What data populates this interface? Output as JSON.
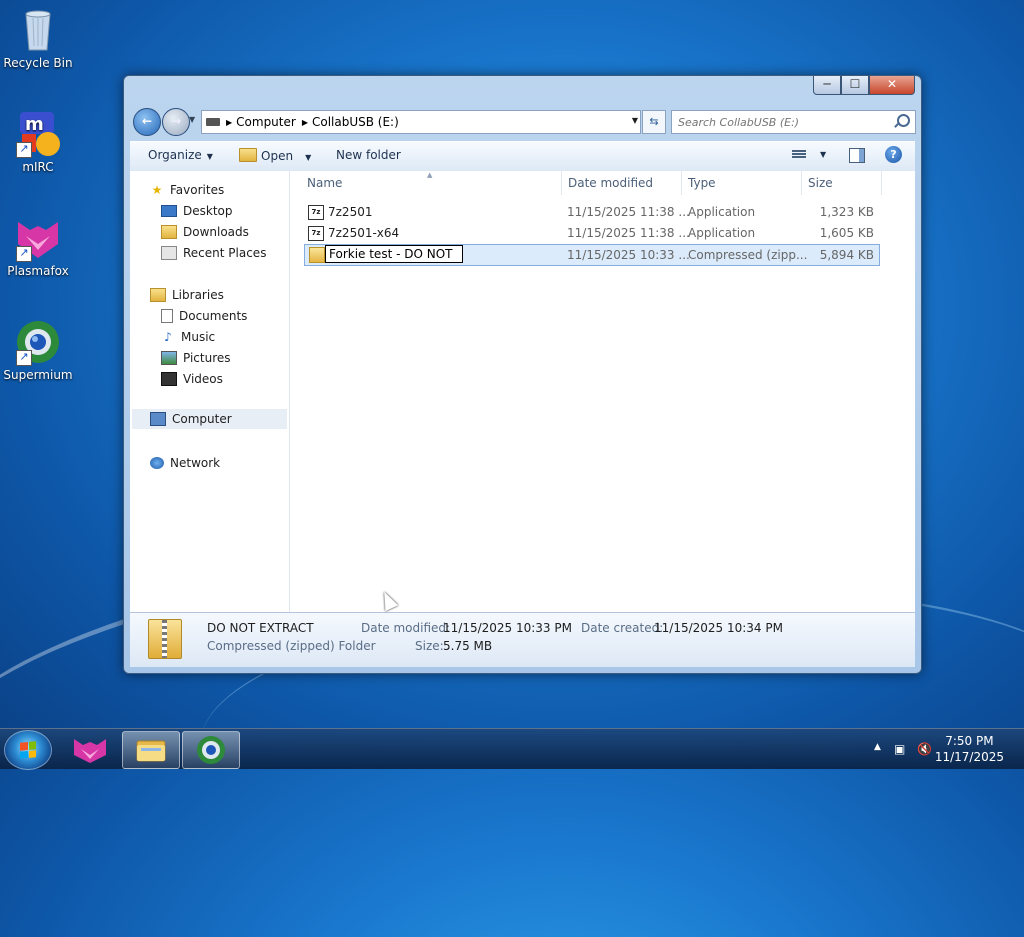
{
  "desktop": {
    "icons": [
      {
        "label": "Recycle Bin"
      },
      {
        "label": "mIRC"
      },
      {
        "label": "Plasmafox"
      },
      {
        "label": "Supermium"
      }
    ]
  },
  "window": {
    "caption": {
      "minimize": "─",
      "maximize": "☐",
      "close": "✕"
    },
    "address": {
      "root": "Computer",
      "drive": "CollabUSB (E:)"
    },
    "search": {
      "placeholder": "Search CollabUSB (E:)"
    },
    "toolbar": {
      "organize": "Organize",
      "open": "Open",
      "new_folder": "New folder"
    },
    "nav": {
      "favorites": "Favorites",
      "desktop": "Desktop",
      "downloads": "Downloads",
      "recent_places": "Recent Places",
      "libraries": "Libraries",
      "documents": "Documents",
      "music": "Music",
      "pictures": "Pictures",
      "videos": "Videos",
      "computer": "Computer",
      "network": "Network"
    },
    "columns": {
      "name": "Name",
      "date": "Date modified",
      "type": "Type",
      "size": "Size"
    },
    "files": [
      {
        "name": "7z2501",
        "date": "11/15/2025 11:38 ...",
        "type": "Application",
        "size": "1,323 KB"
      },
      {
        "name": "7z2501-x64",
        "date": "11/15/2025 11:38 ...",
        "type": "Application",
        "size": "1,605 KB"
      },
      {
        "name": "Forkie test - DO NOT",
        "date": "11/15/2025 10:33 ...",
        "type": "Compressed (zipp...",
        "size": "5,894 KB"
      }
    ],
    "details": {
      "name": "DO NOT EXTRACT",
      "kind": "Compressed (zipped) Folder",
      "modified_label": "Date modified:",
      "modified_value": "11/15/2025 10:33 PM",
      "created_label": "Date created:",
      "created_value": "11/15/2025 10:34 PM",
      "size_label": "Size:",
      "size_value": "5.75 MB"
    }
  },
  "taskbar": {
    "time": "7:50 PM",
    "date": "11/17/2025"
  }
}
